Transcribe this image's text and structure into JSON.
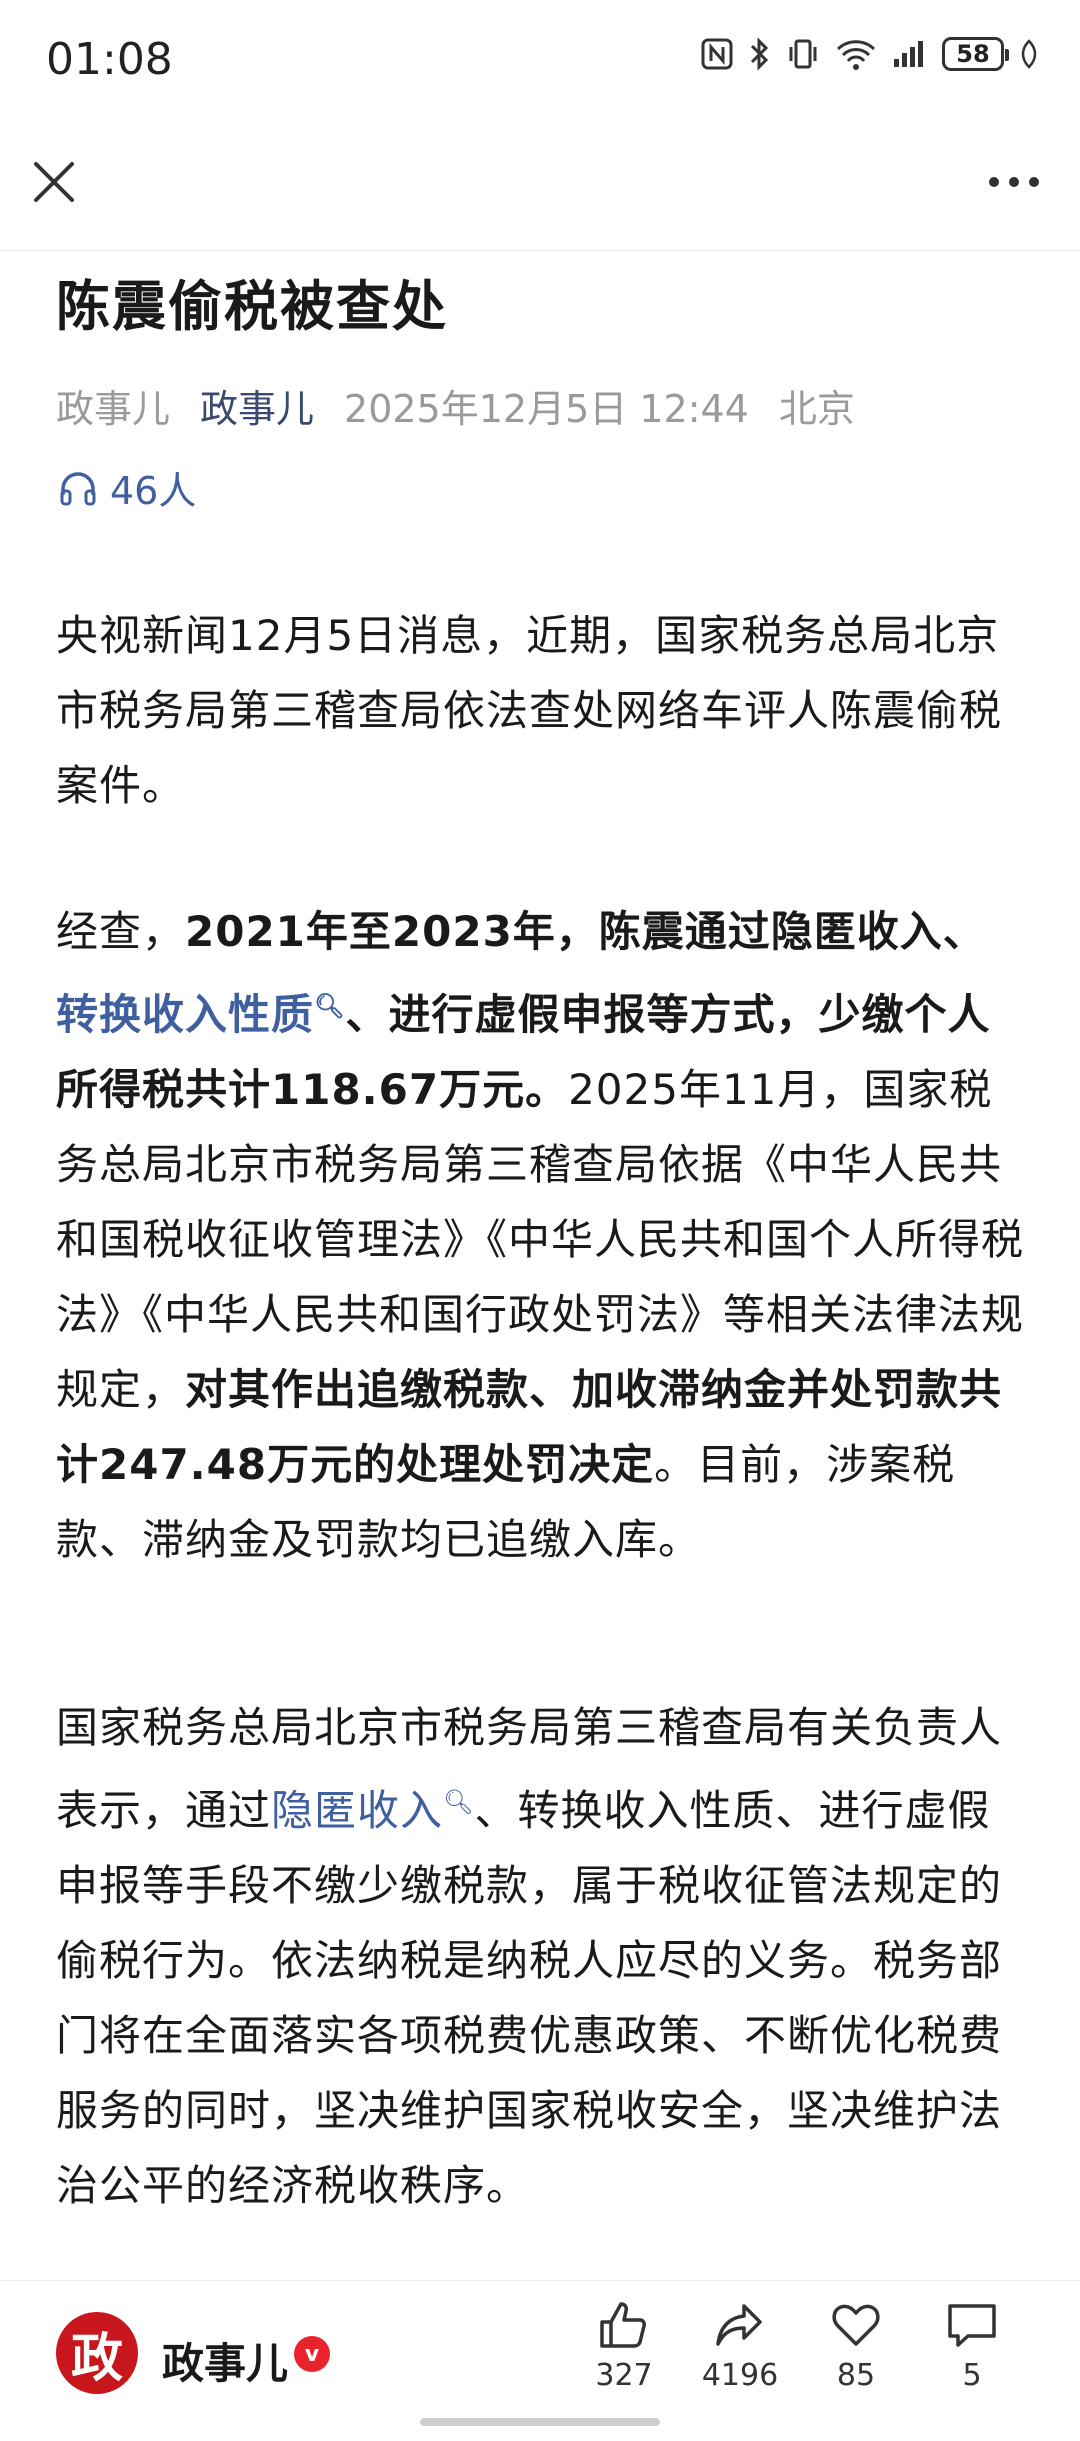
{
  "status_bar": {
    "time": "01:08",
    "battery": "58",
    "icons": [
      "nfc-icon",
      "bluetooth-icon",
      "vibrate-icon",
      "wifi-icon",
      "signal-icon",
      "battery-icon",
      "leaf-icon"
    ]
  },
  "article": {
    "title": "陈震偷税被查处",
    "meta": {
      "source": "政事儿",
      "author_link": "政事儿",
      "datetime": "2025年12月5日 12:44",
      "location": "北京"
    },
    "listeners": "46人",
    "p1": "央视新闻12月5日消息，近期，国家税务总局北京市税务局第三稽查局依法查处网络车评人陈震偷税案件。",
    "p2": {
      "s1": "经查，",
      "s2_bold": "2021年至2023年，陈震通过隐匿收入、",
      "s3_link": "转换收入性质",
      "s4_bold": "、进行虚假申报等方式，少缴个人所得税共计118.67万元。",
      "s5": "2025年11月，国家税务总局北京市税务局第三稽查局依据《中华人民共和国税收征收管理法》《中华人民共和国个人所得税法》《中华人民共和国行政处罚法》等相关法律法规规定，",
      "s6_bold": "对其作出追缴税款、加收滞纳金并处罚款共计247.48万元的处理处罚决定",
      "s7": "。目前，涉案税款、滞纳金及罚款均已追缴入库。"
    },
    "p3": {
      "s1": "国家税务总局北京市税务局第三稽查局有关负责人表示，通过",
      "s2_link": "隐匿收入",
      "s3": "、转换收入性质、进行虚假申报等手段不缴少缴税款，属于税收征管法规定的偷税行为。依法纳税是纳税人应尽的义务。税务部门将在全面落实各项税费优惠政策、不断优化税费服务的同时，坚决维护国家税收安全，坚决维护法治公平的经济税收秩序。"
    }
  },
  "bottom_bar": {
    "account_name": "政事儿",
    "avatar_text": "政",
    "verified_text": "v",
    "likes": "327",
    "shares": "4196",
    "favorites": "85",
    "comments": "5"
  },
  "colors": {
    "link": "#3f5fa0",
    "meta_gray": "#9a9a9a",
    "avatar_red": "#c8161d"
  }
}
